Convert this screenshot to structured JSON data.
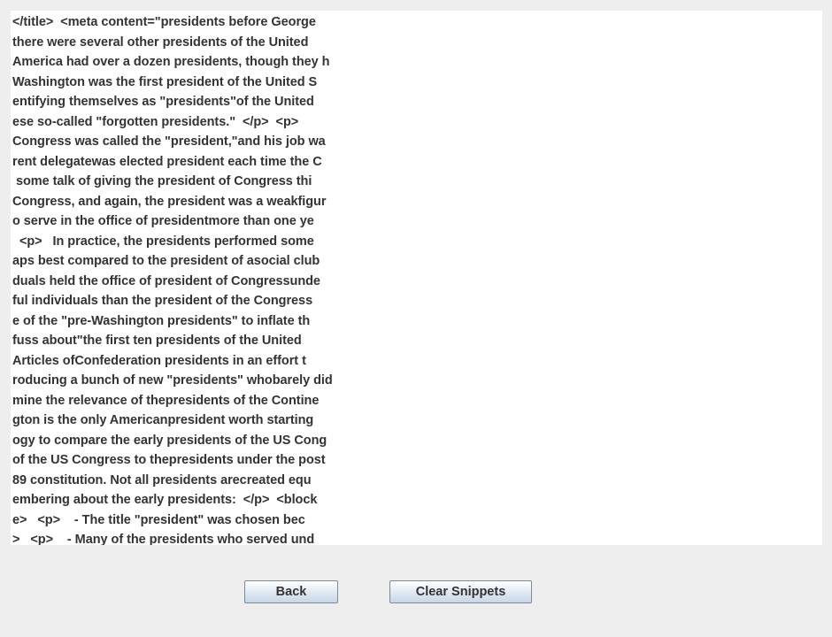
{
  "snippets": {
    "lines": [
      "</title>  <meta content=\"presidents before George",
      "there were several other presidents of the United",
      "America had over a dozen presidents, though they h",
      "Washington was the first president of the United S",
      "entifying themselves as \"presidents\"of the United",
      "ese so-called \"forgotten presidents.\"  </p>  <p>",
      "Congress was called the \"president,\"and his job wa",
      "rent delegatewas elected president each time the C",
      " some talk of giving the president of Congress thi",
      "Congress, and again, the president was a weakfigur",
      "o serve in the office of presidentmore than one ye",
      "  <p>   In practice, the presidents performed some",
      "aps best compared to the president of asocial club",
      "duals held the office of president of Congressunde",
      "ful individuals than the president of the Congress",
      "e of the \"pre-Washington presidents\" to inflate th",
      "fuss about\"the first ten presidents of the United",
      "Articles ofConfederation presidents in an effort t",
      "roducing a bunch of new \"presidents\" whobarely did",
      "mine the relevance of thepresidents of the Contine",
      "gton is the only Americanpresident worth starting",
      "ogy to compare the early presidents of the US Cong",
      "of the US Congress to thepresidents under the post",
      "89 constitution. Not all presidents arecreated equ",
      "embering about the early presidents:  </p>  <block",
      "e>   <p>    - The title \"president\" was chosen bec",
      ">   <p>    - Many of the presidents who served und"
    ]
  },
  "buttons": {
    "back_label": "Back",
    "clear_label": "Clear Snippets"
  }
}
